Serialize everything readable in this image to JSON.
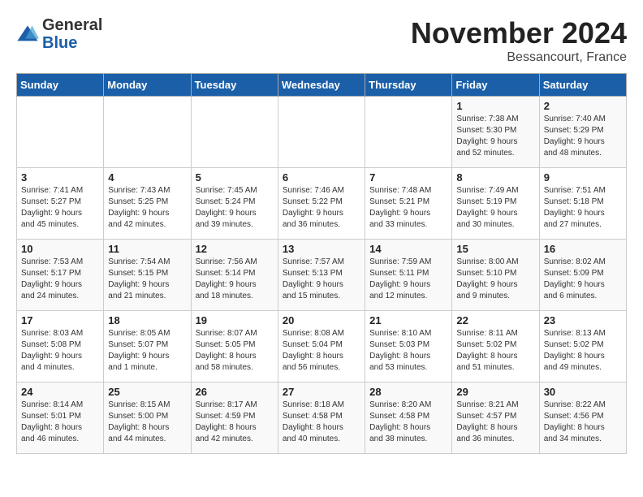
{
  "header": {
    "logo_line1": "General",
    "logo_line2": "Blue",
    "month_title": "November 2024",
    "location": "Bessancourt, France"
  },
  "weekdays": [
    "Sunday",
    "Monday",
    "Tuesday",
    "Wednesday",
    "Thursday",
    "Friday",
    "Saturday"
  ],
  "weeks": [
    [
      {
        "day": "",
        "info": ""
      },
      {
        "day": "",
        "info": ""
      },
      {
        "day": "",
        "info": ""
      },
      {
        "day": "",
        "info": ""
      },
      {
        "day": "",
        "info": ""
      },
      {
        "day": "1",
        "info": "Sunrise: 7:38 AM\nSunset: 5:30 PM\nDaylight: 9 hours\nand 52 minutes."
      },
      {
        "day": "2",
        "info": "Sunrise: 7:40 AM\nSunset: 5:29 PM\nDaylight: 9 hours\nand 48 minutes."
      }
    ],
    [
      {
        "day": "3",
        "info": "Sunrise: 7:41 AM\nSunset: 5:27 PM\nDaylight: 9 hours\nand 45 minutes."
      },
      {
        "day": "4",
        "info": "Sunrise: 7:43 AM\nSunset: 5:25 PM\nDaylight: 9 hours\nand 42 minutes."
      },
      {
        "day": "5",
        "info": "Sunrise: 7:45 AM\nSunset: 5:24 PM\nDaylight: 9 hours\nand 39 minutes."
      },
      {
        "day": "6",
        "info": "Sunrise: 7:46 AM\nSunset: 5:22 PM\nDaylight: 9 hours\nand 36 minutes."
      },
      {
        "day": "7",
        "info": "Sunrise: 7:48 AM\nSunset: 5:21 PM\nDaylight: 9 hours\nand 33 minutes."
      },
      {
        "day": "8",
        "info": "Sunrise: 7:49 AM\nSunset: 5:19 PM\nDaylight: 9 hours\nand 30 minutes."
      },
      {
        "day": "9",
        "info": "Sunrise: 7:51 AM\nSunset: 5:18 PM\nDaylight: 9 hours\nand 27 minutes."
      }
    ],
    [
      {
        "day": "10",
        "info": "Sunrise: 7:53 AM\nSunset: 5:17 PM\nDaylight: 9 hours\nand 24 minutes."
      },
      {
        "day": "11",
        "info": "Sunrise: 7:54 AM\nSunset: 5:15 PM\nDaylight: 9 hours\nand 21 minutes."
      },
      {
        "day": "12",
        "info": "Sunrise: 7:56 AM\nSunset: 5:14 PM\nDaylight: 9 hours\nand 18 minutes."
      },
      {
        "day": "13",
        "info": "Sunrise: 7:57 AM\nSunset: 5:13 PM\nDaylight: 9 hours\nand 15 minutes."
      },
      {
        "day": "14",
        "info": "Sunrise: 7:59 AM\nSunset: 5:11 PM\nDaylight: 9 hours\nand 12 minutes."
      },
      {
        "day": "15",
        "info": "Sunrise: 8:00 AM\nSunset: 5:10 PM\nDaylight: 9 hours\nand 9 minutes."
      },
      {
        "day": "16",
        "info": "Sunrise: 8:02 AM\nSunset: 5:09 PM\nDaylight: 9 hours\nand 6 minutes."
      }
    ],
    [
      {
        "day": "17",
        "info": "Sunrise: 8:03 AM\nSunset: 5:08 PM\nDaylight: 9 hours\nand 4 minutes."
      },
      {
        "day": "18",
        "info": "Sunrise: 8:05 AM\nSunset: 5:07 PM\nDaylight: 9 hours\nand 1 minute."
      },
      {
        "day": "19",
        "info": "Sunrise: 8:07 AM\nSunset: 5:05 PM\nDaylight: 8 hours\nand 58 minutes."
      },
      {
        "day": "20",
        "info": "Sunrise: 8:08 AM\nSunset: 5:04 PM\nDaylight: 8 hours\nand 56 minutes."
      },
      {
        "day": "21",
        "info": "Sunrise: 8:10 AM\nSunset: 5:03 PM\nDaylight: 8 hours\nand 53 minutes."
      },
      {
        "day": "22",
        "info": "Sunrise: 8:11 AM\nSunset: 5:02 PM\nDaylight: 8 hours\nand 51 minutes."
      },
      {
        "day": "23",
        "info": "Sunrise: 8:13 AM\nSunset: 5:02 PM\nDaylight: 8 hours\nand 49 minutes."
      }
    ],
    [
      {
        "day": "24",
        "info": "Sunrise: 8:14 AM\nSunset: 5:01 PM\nDaylight: 8 hours\nand 46 minutes."
      },
      {
        "day": "25",
        "info": "Sunrise: 8:15 AM\nSunset: 5:00 PM\nDaylight: 8 hours\nand 44 minutes."
      },
      {
        "day": "26",
        "info": "Sunrise: 8:17 AM\nSunset: 4:59 PM\nDaylight: 8 hours\nand 42 minutes."
      },
      {
        "day": "27",
        "info": "Sunrise: 8:18 AM\nSunset: 4:58 PM\nDaylight: 8 hours\nand 40 minutes."
      },
      {
        "day": "28",
        "info": "Sunrise: 8:20 AM\nSunset: 4:58 PM\nDaylight: 8 hours\nand 38 minutes."
      },
      {
        "day": "29",
        "info": "Sunrise: 8:21 AM\nSunset: 4:57 PM\nDaylight: 8 hours\nand 36 minutes."
      },
      {
        "day": "30",
        "info": "Sunrise: 8:22 AM\nSunset: 4:56 PM\nDaylight: 8 hours\nand 34 minutes."
      }
    ]
  ]
}
